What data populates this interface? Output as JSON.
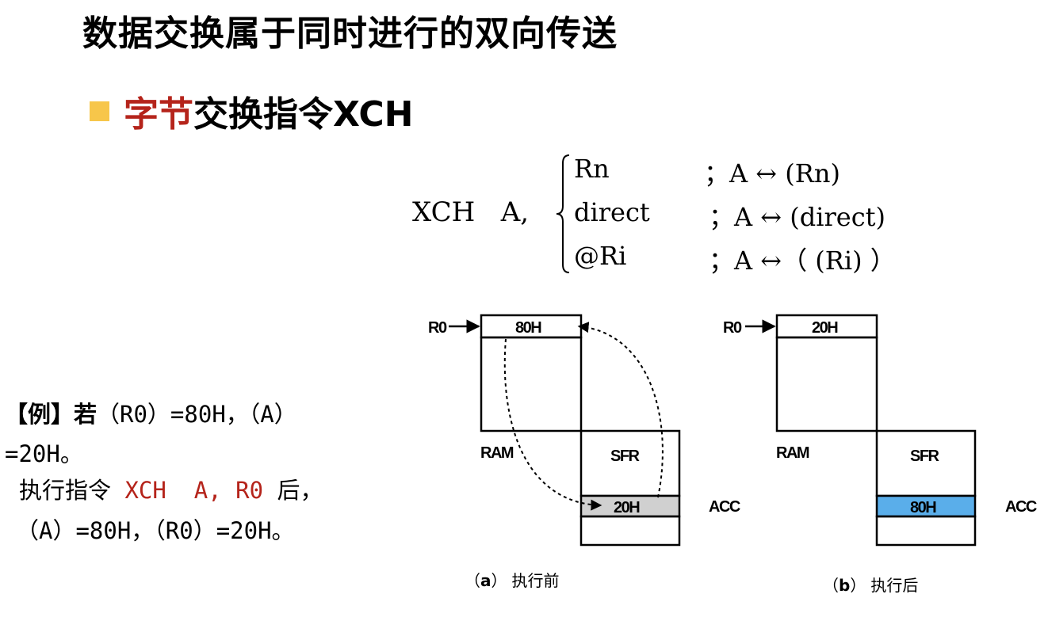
{
  "title": "数据交换属于同时进行的双向传送",
  "subtitle": {
    "red_part": "字节",
    "rest": "交换指令XCH"
  },
  "instruction": {
    "mnemonic": "XCH   A,",
    "operands": [
      {
        "operand": "Rn",
        "description": "；A ↔ (Rn)"
      },
      {
        "operand": "direct",
        "description": "；A ↔ (direct)"
      },
      {
        "operand": "@Ri",
        "description": "；A ↔（ (Ri) ）"
      }
    ]
  },
  "example": {
    "line1_bold": "【例】若",
    "line1_rest": "（R0）=80H，（A）",
    "line2": "=20H。",
    "line3_pre": "执行指令 ",
    "line3_red": "XCH  A, R0",
    "line3_post": " 后，",
    "line4": "（A）=80H，（R0）=20H。"
  },
  "diagram_before": {
    "pointer_label": "R0",
    "ram_cell_value": "80H",
    "ram_label": "RAM",
    "sfr_label": "SFR",
    "acc_value": "20H",
    "acc_label": "ACC",
    "caption_letter": "a",
    "caption_text": "执行前",
    "acc_fill": "#d0d0d0"
  },
  "diagram_after": {
    "pointer_label": "R0",
    "ram_cell_value": "20H",
    "ram_label": "RAM",
    "sfr_label": "SFR",
    "acc_value": "80H",
    "acc_label": "ACC",
    "caption_letter": "b",
    "caption_text": "执行后",
    "acc_fill": "#5aaeea"
  }
}
